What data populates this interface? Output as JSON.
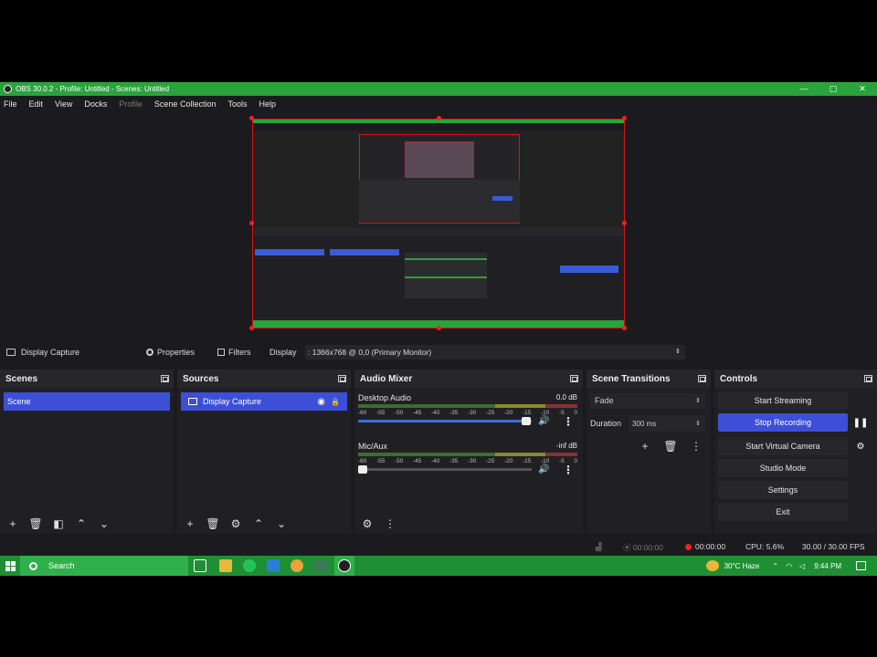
{
  "window": {
    "title": "OBS 30.0.2 - Profile: Untitled - Scenes: Untitled",
    "minimize": "—",
    "maximize": "▢",
    "close": "✕"
  },
  "menu": [
    {
      "label": "File"
    },
    {
      "label": "Edit"
    },
    {
      "label": "View"
    },
    {
      "label": "Docks"
    },
    {
      "label": "Profile"
    },
    {
      "label": "Scene Collection"
    },
    {
      "label": "Tools"
    },
    {
      "label": "Help"
    }
  ],
  "source_toolbar": {
    "source_name": "Display Capture",
    "properties": "Properties",
    "filters": "Filters",
    "display_label": "Display",
    "display_value": ": 1366x768 @ 0,0 (Primary Monitor)"
  },
  "scenes": {
    "title": "Scenes",
    "items": [
      "Scene"
    ]
  },
  "sources": {
    "title": "Sources",
    "items": [
      "Display Capture"
    ]
  },
  "audio_mixer": {
    "title": "Audio Mixer",
    "channels": [
      {
        "name": "Desktop Audio",
        "db": "0.0 dB",
        "volume": 0.97
      },
      {
        "name": "Mic/Aux",
        "db": "-inf dB",
        "volume": 0.0
      }
    ],
    "ticks": [
      "-60",
      "-55",
      "-50",
      "-45",
      "-40",
      "-35",
      "-30",
      "-25",
      "-20",
      "-15",
      "-10",
      "-5",
      "0"
    ]
  },
  "scene_transitions": {
    "title": "Scene Transitions",
    "transition": "Fade",
    "duration_label": "Duration",
    "duration_value": "300 ms"
  },
  "controls": {
    "title": "Controls",
    "start_streaming": "Start Streaming",
    "stop_recording": "Stop Recording",
    "start_virtual_camera": "Start Virtual Camera",
    "studio_mode": "Studio Mode",
    "settings": "Settings",
    "exit": "Exit"
  },
  "status": {
    "stream_time": "00:00:00",
    "rec_time": "00:00:00",
    "cpu": "CPU: 5.6%",
    "fps": "30.00 / 30.00 FPS"
  },
  "taskbar": {
    "search_label": "Search",
    "weather": "30°C Haze",
    "time": "9:44 PM"
  },
  "colors": {
    "accent_green": "#2aa33c",
    "selection_blue": "#3d4fd6",
    "record_red": "#e22222"
  }
}
